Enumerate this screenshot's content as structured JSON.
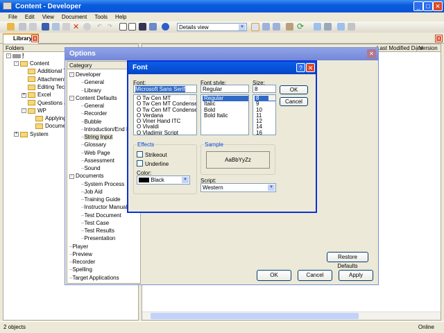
{
  "window": {
    "title": "Content - Developer"
  },
  "menu": [
    "File",
    "Edit",
    "View",
    "Document",
    "Tools",
    "Help"
  ],
  "toolbar": {
    "view_select": "Details view"
  },
  "tabs": {
    "library": "Library"
  },
  "folders": {
    "header": "Folders",
    "root": "!",
    "items": [
      {
        "label": "Content",
        "level": 1,
        "exp": "-"
      },
      {
        "label": "Additional Top",
        "level": 2
      },
      {
        "label": "Attachments",
        "level": 2
      },
      {
        "label": "Editing Techni",
        "level": 2
      },
      {
        "label": "Excel",
        "level": 2,
        "exp": "+"
      },
      {
        "label": "Questions and",
        "level": 2
      },
      {
        "label": "WP",
        "level": 2,
        "exp": "-"
      },
      {
        "label": "Applying F",
        "level": 3
      },
      {
        "label": "Document",
        "level": 3
      },
      {
        "label": "System",
        "level": 1,
        "exp": "+"
      }
    ]
  },
  "list": {
    "columns": [
      "Last Modified Date",
      "Version"
    ]
  },
  "status": {
    "count": "2 objects",
    "connection": "Online"
  },
  "options": {
    "title": "Options",
    "category_header": "Category",
    "categories": [
      {
        "label": "Developer",
        "level": 0,
        "exp": "-"
      },
      {
        "label": "General",
        "level": 1
      },
      {
        "label": "Library",
        "level": 1
      },
      {
        "label": "Content Defaults",
        "level": 0,
        "exp": "-"
      },
      {
        "label": "General",
        "level": 1
      },
      {
        "label": "Recorder",
        "level": 1
      },
      {
        "label": "Bubble",
        "level": 1
      },
      {
        "label": "Introduction/End Frame",
        "level": 1
      },
      {
        "label": "String Input",
        "level": 1,
        "selected": true
      },
      {
        "label": "Glossary",
        "level": 1
      },
      {
        "label": "Web Page",
        "level": 1
      },
      {
        "label": "Assessment",
        "level": 1
      },
      {
        "label": "Sound",
        "level": 1
      },
      {
        "label": "Documents",
        "level": 0,
        "exp": "-"
      },
      {
        "label": "System Process",
        "level": 1
      },
      {
        "label": "Job Aid",
        "level": 1
      },
      {
        "label": "Training Guide",
        "level": 1
      },
      {
        "label": "Instructor Manual",
        "level": 1
      },
      {
        "label": "Test Document",
        "level": 1
      },
      {
        "label": "Test Case",
        "level": 1
      },
      {
        "label": "Test Results",
        "level": 1
      },
      {
        "label": "Presentation",
        "level": 1
      },
      {
        "label": "Player",
        "level": 0
      },
      {
        "label": "Preview",
        "level": 0
      },
      {
        "label": "Recorder",
        "level": 0
      },
      {
        "label": "Spelling",
        "level": 0
      },
      {
        "label": "Target Applications",
        "level": 0
      }
    ],
    "restore": "Restore Defaults",
    "ok": "OK",
    "cancel": "Cancel",
    "apply": "Apply"
  },
  "font": {
    "title": "Font",
    "font_label": "Font:",
    "font_value": "Microsoft Sans Serif",
    "fonts": [
      "Tw Cen MT",
      "Tw Cen MT Condensed",
      "Tw Cen MT Condensed",
      "Verdana",
      "Viner Hand ITC",
      "Vivaldi",
      "Vladimir Script"
    ],
    "style_label": "Font style:",
    "style_value": "Regular",
    "styles": [
      "Regular",
      "Italic",
      "Bold",
      "Bold Italic"
    ],
    "size_label": "Size:",
    "size_value": "8",
    "sizes": [
      "8",
      "9",
      "10",
      "11",
      "12",
      "14",
      "16"
    ],
    "ok": "OK",
    "cancel": "Cancel",
    "effects": "Effects",
    "strikeout": "Strikeout",
    "underline": "Underline",
    "color_label": "Color:",
    "color_value": "Black",
    "sample_label": "Sample",
    "sample_text": "AaBbYyZz",
    "script_label": "Script:",
    "script_value": "Western"
  }
}
